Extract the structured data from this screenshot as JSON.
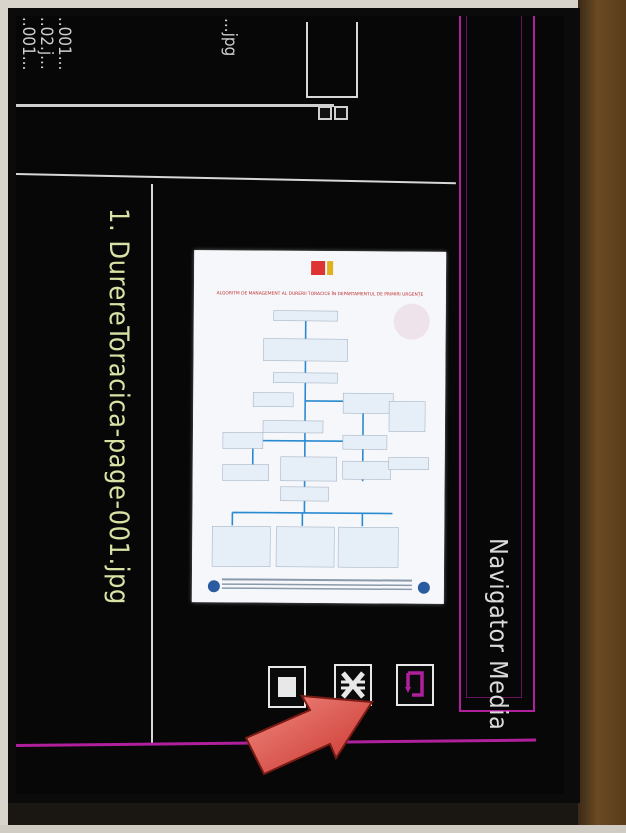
{
  "panel": {
    "title": "Navigator Media"
  },
  "file_list": {
    "items": [
      "...jpg",
      "...001...",
      "...02.j...",
      "...001..."
    ]
  },
  "preview": {
    "caption": "1. DurereToracica-page-001.jpg"
  },
  "document_preview": {
    "heading": "ALGORITM DE MANAGEMENT AL DURERII TORACICE ÎN DEPARTAMENTUL DE PRIMIRI URGENȚE"
  },
  "controls": {
    "stop": "stop",
    "shuffle": "shuffle",
    "repeat": "repeat"
  },
  "colors": {
    "accent": "#b0209c",
    "caption": "#d7e3a4",
    "arrow": "#e0564f"
  }
}
